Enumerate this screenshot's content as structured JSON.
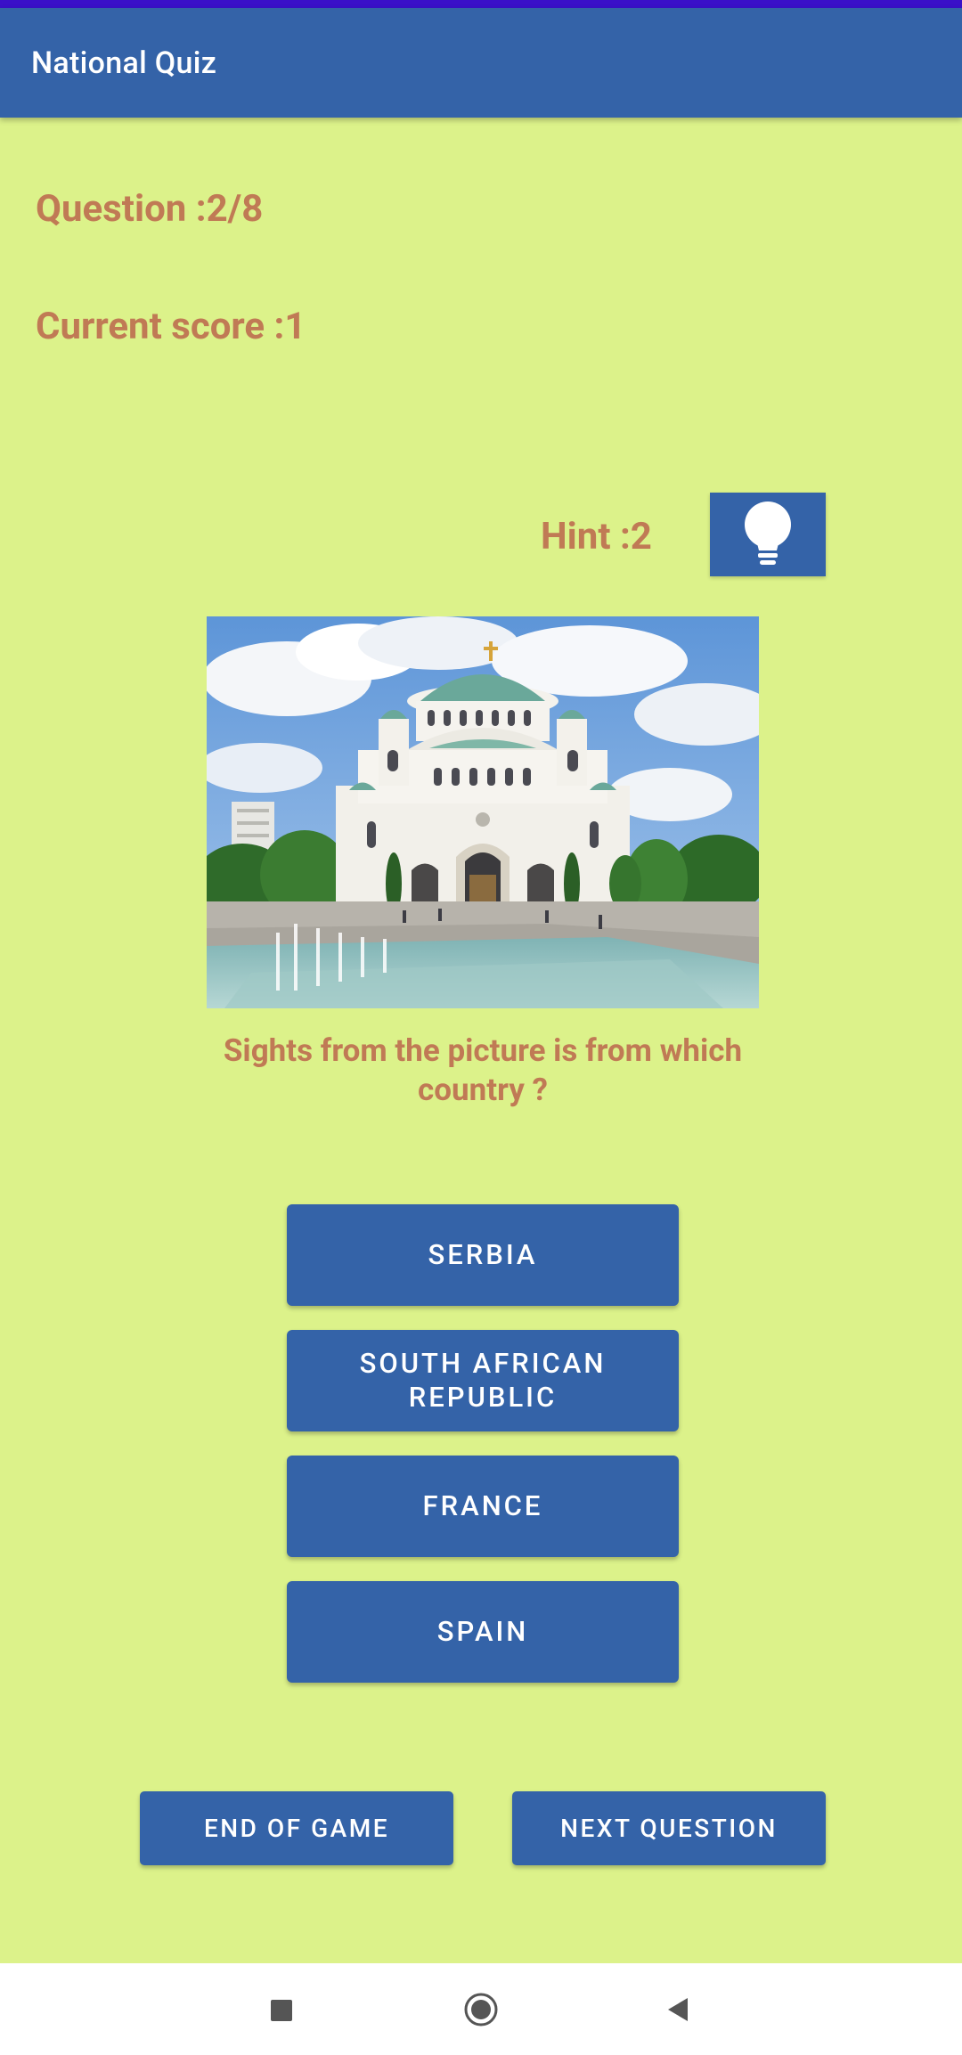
{
  "app": {
    "title": "National Quiz"
  },
  "status": {
    "question": "Question :2/8",
    "score": "Current score :1"
  },
  "hint": {
    "label": "Hint :2",
    "icon": "lightbulb-icon"
  },
  "question": {
    "image_description": "Church of Saint Sava, Belgrade",
    "text": "Sights from the picture is from which country ?"
  },
  "answers": [
    "SERBIA",
    "SOUTH AFRICAN REPUBLIC",
    "FRANCE",
    "SPAIN"
  ],
  "actions": {
    "end_game": "END OF GAME",
    "next_question": "NEXT QUESTION"
  },
  "nav": {
    "icons": [
      "recents-square-icon",
      "home-circle-icon",
      "back-triangle-icon"
    ]
  },
  "colors": {
    "primary": "#3463a8",
    "background": "#dcf28a",
    "text_accent": "#c07a55",
    "status_bar": "#3a10c8"
  }
}
